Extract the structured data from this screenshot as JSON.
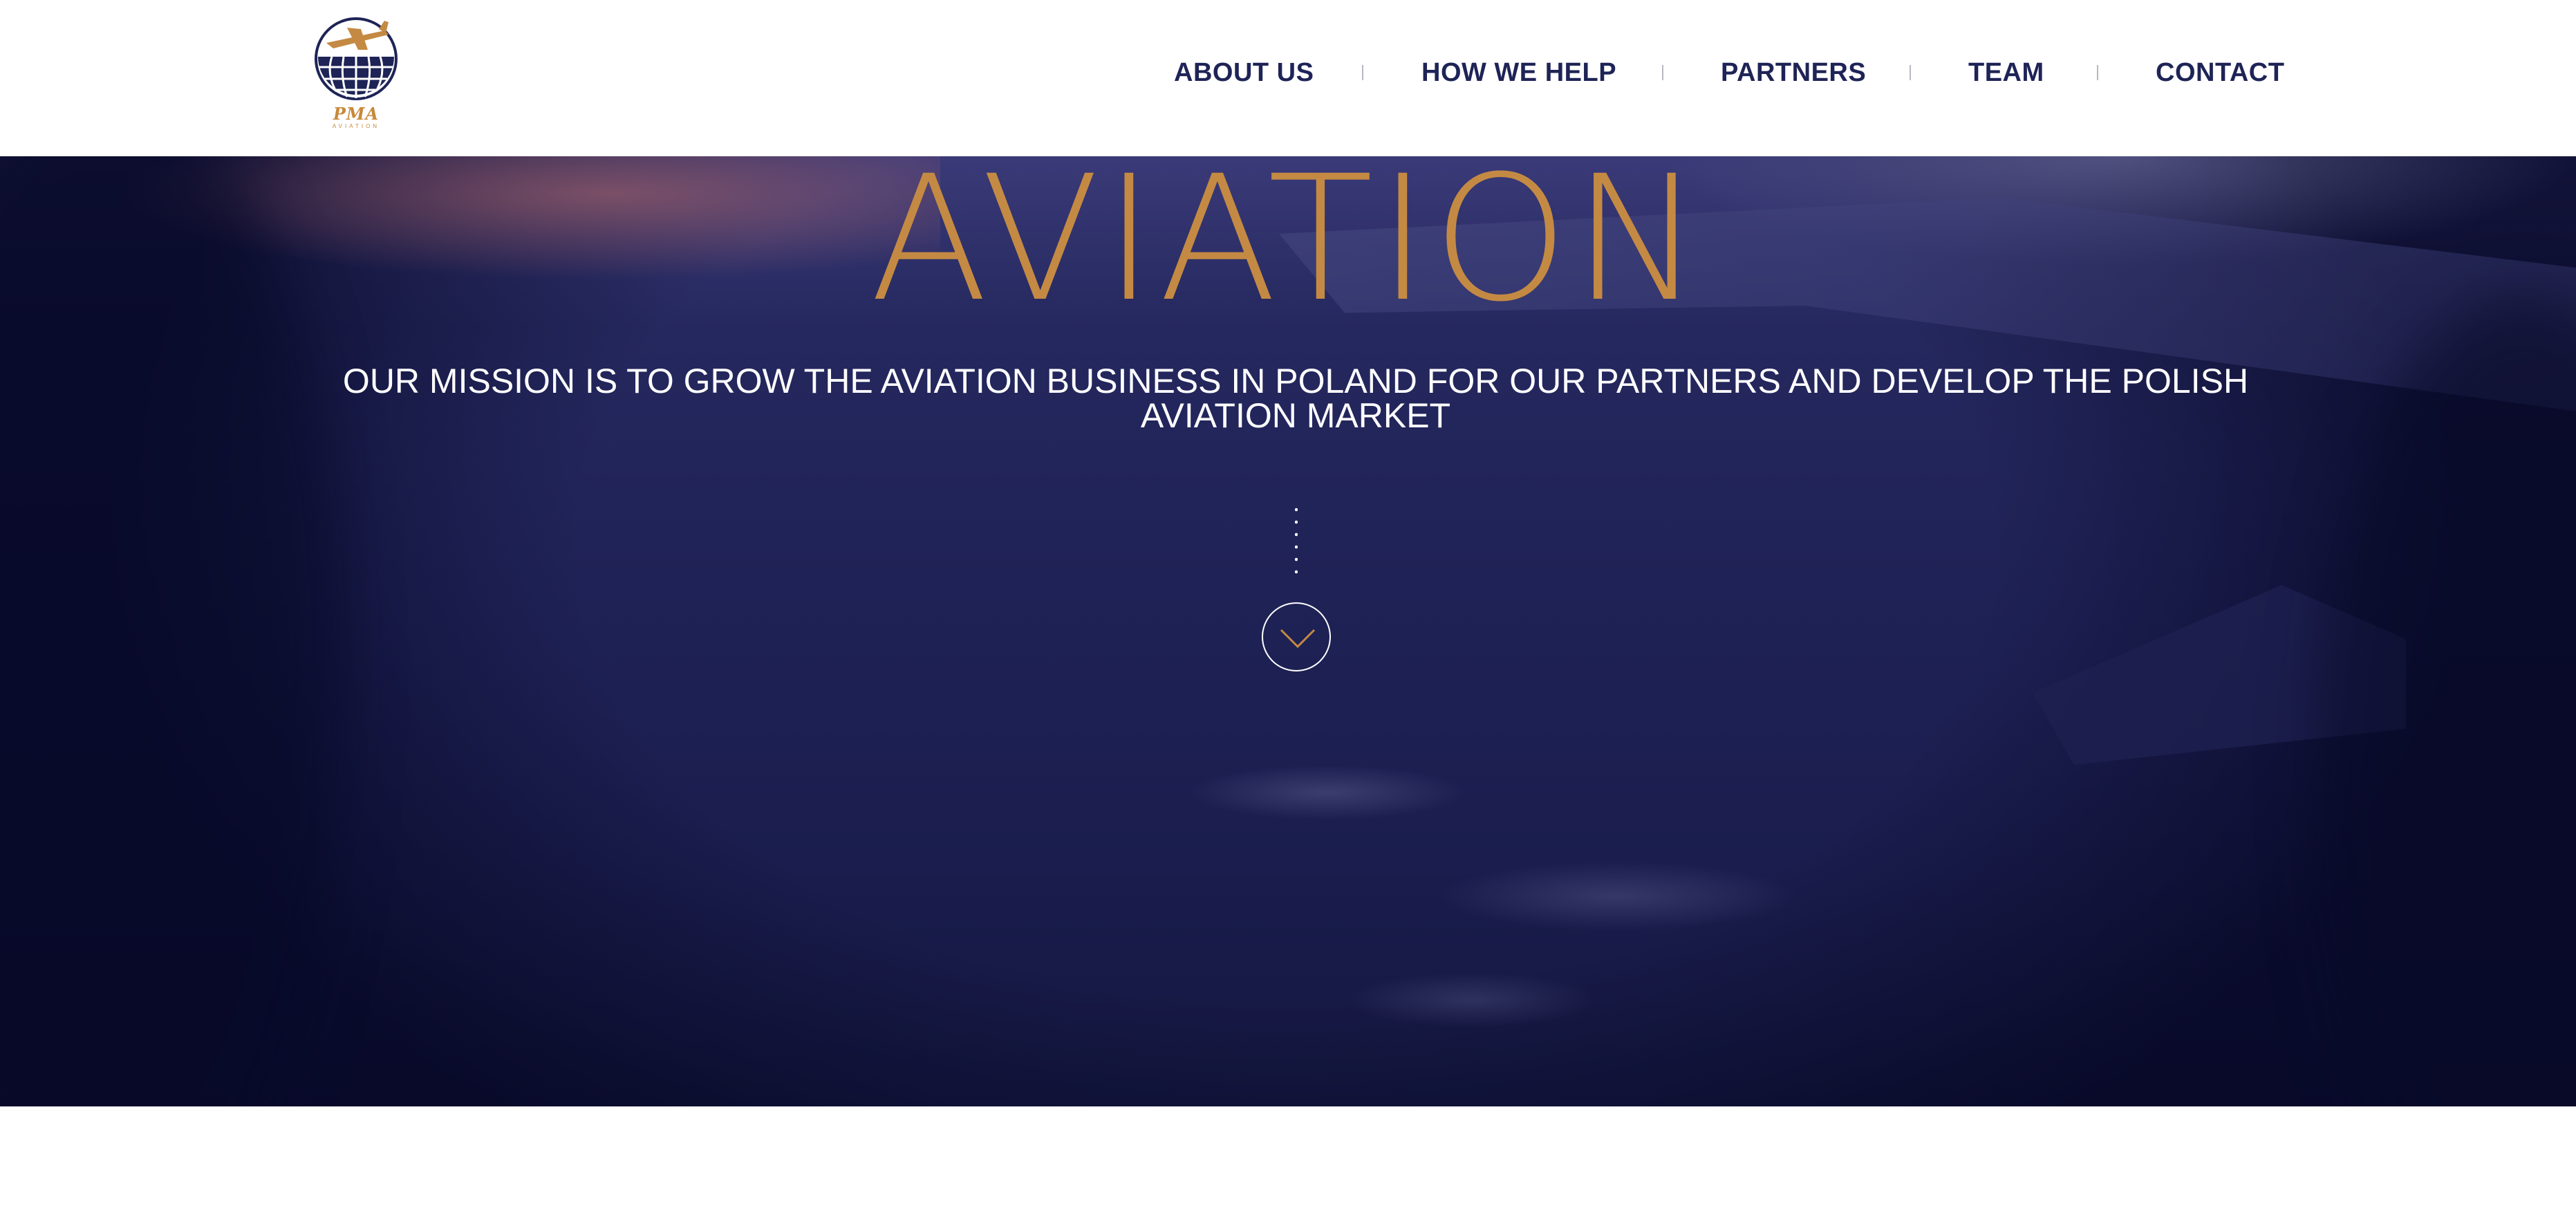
{
  "header": {
    "logo": {
      "name": "pma-logo",
      "text": "PMA",
      "subtext": "AVIATION"
    },
    "nav": [
      {
        "label": "ABOUT US"
      },
      {
        "label": "HOW WE HELP"
      },
      {
        "label": "PARTNERS"
      },
      {
        "label": "TEAM"
      },
      {
        "label": "CONTACT"
      }
    ]
  },
  "hero": {
    "title": "AVIATION",
    "mission": "OUR MISSION IS TO GROW THE AVIATION BUSINESS IN POLAND FOR OUR PARTNERS AND DEVELOP THE POLISH AVIATION MARKET",
    "scroll_icon": "chevron-down-icon"
  },
  "colors": {
    "brand_navy": "#1e2456",
    "accent_gold": "#c48a43",
    "hero_bg": "#1f2256"
  }
}
